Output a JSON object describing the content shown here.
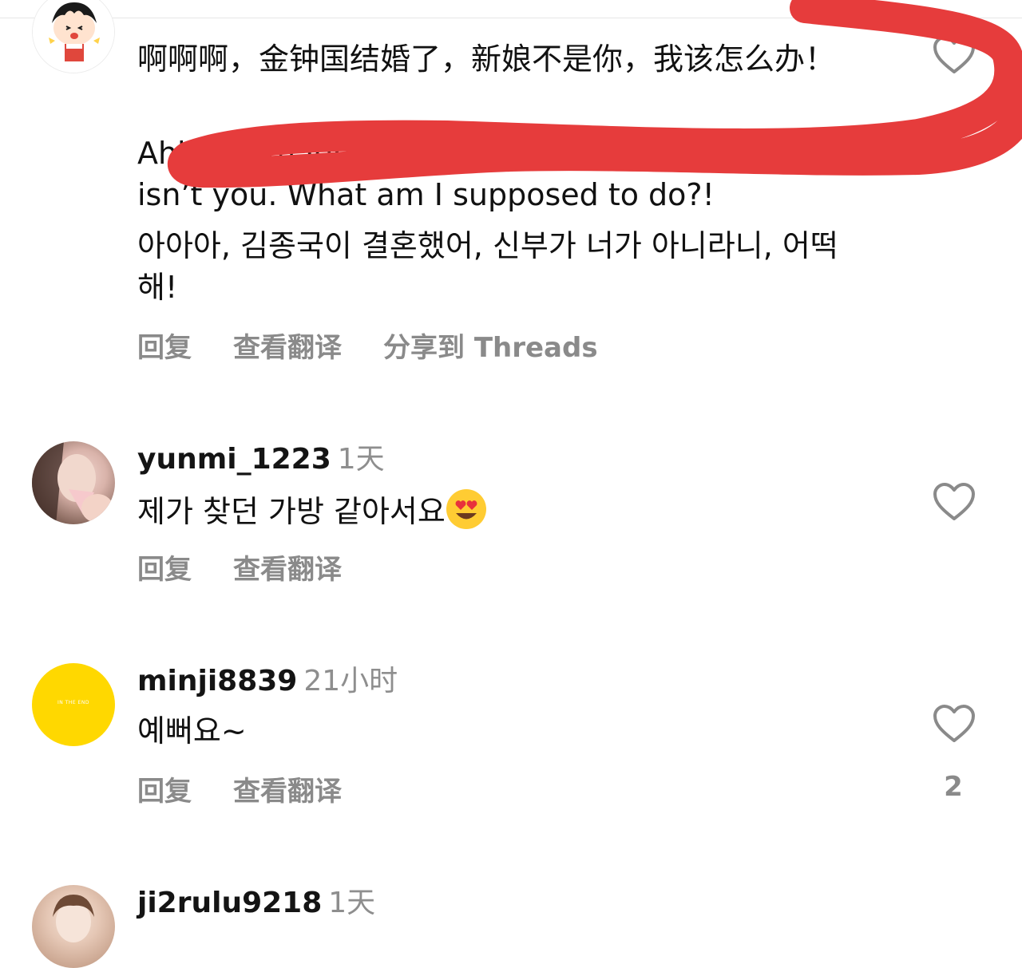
{
  "comments": [
    {
      "username": "",
      "time": "",
      "text_zh": "啊啊啊，金钟国结婚了，新娘不是你，我该怎么办！",
      "text_en": "Ahhh! Kim Jong-kook got married, the bride isn’t you. What am I supposed to do?!",
      "text_ko": "아아아, 김종국이 결혼했어, 신부가 너가 아니라니, 어떡해!",
      "actions": [
        "回复",
        "查看翻译",
        "分享到 Threads"
      ]
    },
    {
      "username": "yunmi_1223",
      "time": "1天",
      "text": "제가 찾던 가방 같아서요",
      "emoji": "heart-eyes-emoji",
      "actions": [
        "回复",
        "查看翻译"
      ]
    },
    {
      "username": "minji8839",
      "time": "21小时",
      "avatar_text": "IN THE END",
      "text": "예뻐요~",
      "actions": [
        "回复",
        "查看翻译"
      ],
      "like_count": "2"
    },
    {
      "username": "ji2rulu9218",
      "time": "1天"
    }
  ],
  "colors": {
    "scribble": "#e63c3c",
    "muted": "#8e8e8e",
    "avatar_yellow": "#ffd800"
  }
}
